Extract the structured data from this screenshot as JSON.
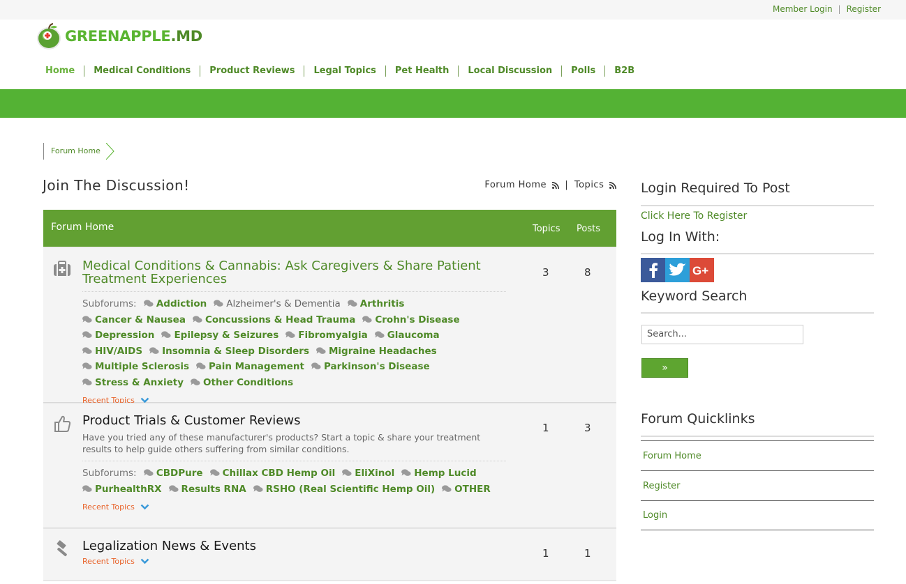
{
  "topbar": {
    "member_login": "Member Login",
    "sep": "|",
    "register": "Register"
  },
  "logo": {
    "text_green": "GREENAPPLE",
    "text_dot": ".MD",
    "icon": "apple-cross-icon"
  },
  "nav": {
    "items": [
      "Home",
      "Medical Conditions",
      "Product Reviews",
      "Legal Topics",
      "Pet Health",
      "Local Discussion",
      "Polls",
      "B2B"
    ]
  },
  "breadcrumb": {
    "label": "Forum Home"
  },
  "page": {
    "title": "Join The Discussion!",
    "feed_forum": "Forum Home",
    "feed_sep": "|",
    "feed_topics": "Topics"
  },
  "table": {
    "header": {
      "title": "Forum Home",
      "topics": "Topics",
      "posts": "Posts"
    },
    "rows": [
      {
        "icon": "medkit-icon",
        "title": "Medical Conditions & Cannabis: Ask Caregivers & Share Patient Treatment Experiences",
        "topics": "3",
        "posts": "8",
        "subforums_label": "Subforums:",
        "subforums": [
          "Addiction",
          "Alzheimer's & Dementia",
          "Arthritis",
          "Cancer & Nausea",
          "Concussions & Head Trauma",
          "Crohn's Disease",
          "Depression",
          "Epilepsy & Seizures",
          "Fibromyalgia",
          "Glaucoma",
          "HIV/AIDS",
          "Insomnia & Sleep Disorders",
          "Migraine Headaches",
          "Multiple Sclerosis",
          "Pain Management",
          "Parkinson's Disease",
          "Stress & Anxiety",
          "Other Conditions"
        ],
        "recent": "Recent Topics"
      },
      {
        "icon": "thumbs-up-icon",
        "title": "Product Trials & Customer Reviews",
        "description": "Have you tried any of these manufacturer's products? Start a topic & share your treatment results to help guide others suffering from similar conditions.",
        "topics": "1",
        "posts": "3",
        "subforums_label": "Subforums:",
        "subforums": [
          "CBDPure",
          "Chillax CBD Hemp Oil",
          "EliXinol",
          "Hemp Lucid",
          "PurhealthRX",
          "Results RNA",
          "RSHO (Real Scientific Hemp Oil)",
          "OTHER"
        ],
        "recent": "Recent Topics"
      },
      {
        "icon": "gavel-icon",
        "title": "Legalization News & Events",
        "topics": "1",
        "posts": "1",
        "recent": "Recent Topics"
      }
    ]
  },
  "sidebar": {
    "login_heading": "Login Required To Post",
    "register_link": "Click Here To Register",
    "login_with": "Log In With:",
    "social": [
      "facebook-icon",
      "twitter-icon",
      "google-plus-icon"
    ],
    "search_heading": "Keyword Search",
    "search_placeholder": "Search...",
    "search_button": "»",
    "quicklinks_heading": "Forum Quicklinks",
    "quicklinks": [
      "Forum Home",
      "Register",
      "Login"
    ]
  },
  "colors": {
    "brand_green": "#54b234",
    "header_green": "#62a032",
    "link_green": "#4f8a28",
    "orange": "#e8632a"
  }
}
